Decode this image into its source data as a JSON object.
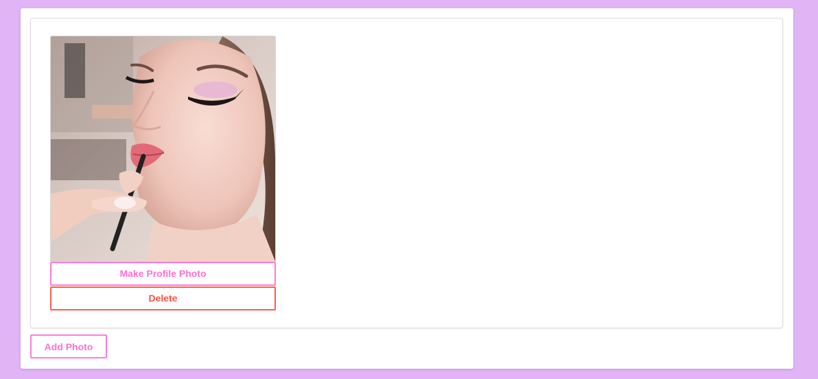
{
  "gallery": {
    "photos": [
      {
        "actions": {
          "make_profile_label": "Make Profile Photo",
          "delete_label": "Delete"
        }
      }
    ]
  },
  "add_photo_label": "Add Photo",
  "colors": {
    "background": "#e0b4f5",
    "accent_pink": "#ff6fd0",
    "danger_red": "#ff4f45"
  }
}
